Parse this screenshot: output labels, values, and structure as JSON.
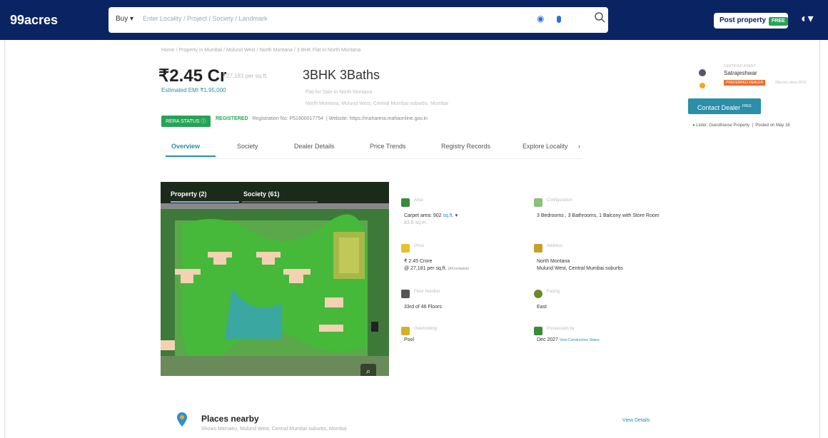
{
  "header": {
    "logo": "99acres",
    "buy_label": "Buy",
    "search_placeholder": "Enter Locality / Project / Society / Landmark",
    "post_property_label": "Post property",
    "free_badge": "FREE"
  },
  "breadcrumb": "Home / Property in Mumbai / Mulund West / North Montana / 3 BHK Flat in North Montana",
  "listing": {
    "price": "₹2.45 Cr",
    "price_per_sqft": "₹27,181 per sq.ft.",
    "emi": "Estimated EMI ₹1.95,000",
    "bhk_title": "3BHK 3Baths",
    "bhk_sub1": "Flat for Sale in North Montana",
    "bhk_sub2": "North Montana, Mulund West, Central Mumbai suburbs, Mumbai",
    "rera_badge": "RERA STATUS",
    "rera_status": "REGISTERED",
    "registration": "Registration No: P51800017754",
    "website": "Website: https://maharera.mahaonline.gov.in"
  },
  "tabs": [
    {
      "label": "Overview",
      "active": true
    },
    {
      "label": "Society",
      "active": false
    },
    {
      "label": "Dealer Details",
      "active": false
    },
    {
      "label": "Price Trends",
      "active": false
    },
    {
      "label": "Registry Records",
      "active": false
    },
    {
      "label": "Explore Locality",
      "active": false
    }
  ],
  "gallery": {
    "tab_property": "Property (2)",
    "tab_society": "Society (61)"
  },
  "details": {
    "area_label": "Area",
    "area_value": "Carpet area: 902",
    "area_unit": "sq.ft.",
    "area_sub": "83.8 sq.m.",
    "config_label": "Configuration",
    "config_value": "3 Bedrooms , 3 Bathrooms, 1 Balcony with Store Room",
    "price_label": "Price",
    "price_value": "₹ 2.45 Crore",
    "price_sub": "@ 27,181 per sq.ft.",
    "price_note": "(All inclusive)",
    "address_label": "Address",
    "address_line1": "North Montana",
    "address_line2": "Mulund West, Central Mumbai suburbs",
    "floor_label": "Floor Number",
    "floor_value": "33rd of 46 Floors",
    "facing_label": "Facing",
    "facing_value": "East",
    "overlooking_label": "Overlooking",
    "overlooking_value": "Pool",
    "possession_label": "Possession by",
    "possession_value": "Dec 2027",
    "possession_link": "View Construction Status"
  },
  "dealer": {
    "heading": "CERTIFIED AGENT",
    "name": "Satrajeshwar",
    "badge": "PREFERRED DEALER",
    "extra": "99acres since 2015",
    "contact_label": "Contact Dealer",
    "contact_badge": "FREE",
    "posted_note": "Lister: Guesthouse Property",
    "posted_date": "Posted on May 16"
  },
  "places": {
    "title": "Places nearby",
    "subtitle": "Shows Marsaeu, Mulund West, Central Mumbai suburbs, Mumbai",
    "view_label": "View Details"
  },
  "colors": {
    "header_bg": "#0a2463",
    "accent": "#2a8fa8",
    "green": "#25a456"
  }
}
